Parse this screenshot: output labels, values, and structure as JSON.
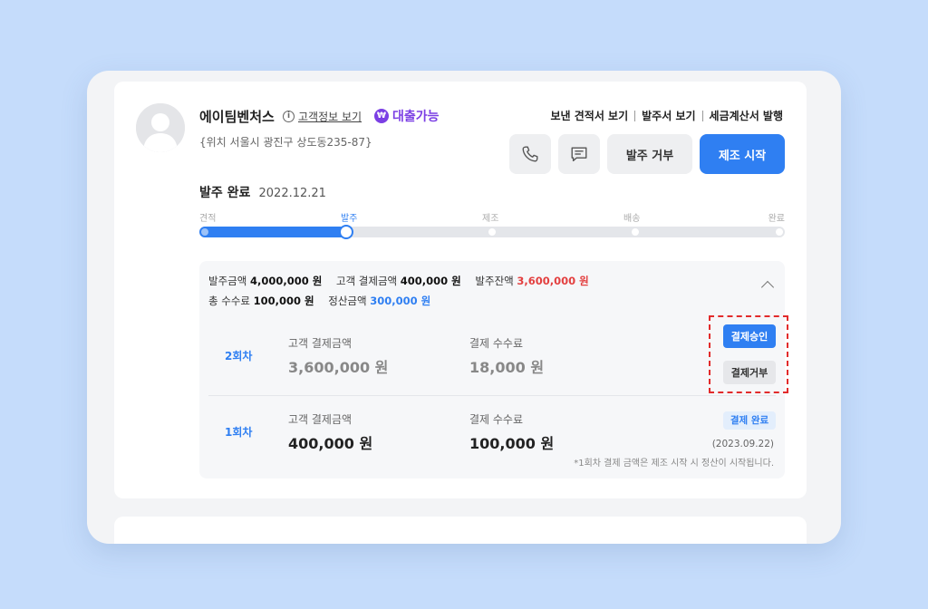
{
  "customer": {
    "name": "에이팀벤처스",
    "info_link": "고객정보 보기",
    "info_icon": "info-icon",
    "loan_badge": "대출가능",
    "loan_icon_glyph": "₩",
    "address": "{위치 서울시 광진구 상도동235-87}"
  },
  "header_links": [
    "보낸 견적서 보기",
    "발주서 보기",
    "세금계산서 발행"
  ],
  "actions": {
    "phone_icon": "phone-icon",
    "chat_icon": "chat-icon",
    "refuse_label": "발주 거부",
    "start_label": "제조 시작"
  },
  "status": {
    "label": "발주 완료",
    "date": "2022.12.21"
  },
  "progress": {
    "steps": [
      "견적",
      "발주",
      "제조",
      "배송",
      "완료"
    ],
    "current_index": 1
  },
  "summary": {
    "order_amount_label": "발주금액",
    "order_amount": "4,000,000 원",
    "customer_paid_label": "고객 결제금액",
    "customer_paid": "400,000 원",
    "order_balance_label": "발주잔액",
    "order_balance": "3,600,000 원",
    "total_fee_label": "총 수수료",
    "total_fee": "100,000 원",
    "settlement_label": "정산금액",
    "settlement": "300,000 원"
  },
  "payments": [
    {
      "round": "2회차",
      "amount_label": "고객 결제금액",
      "amount": "3,600,000 원",
      "fee_label": "결제 수수료",
      "fee": "18,000 원",
      "approve_label": "결제승인",
      "reject_label": "결제거부"
    },
    {
      "round": "1회차",
      "amount_label": "고객 결제금액",
      "amount": "400,000 원",
      "fee_label": "결제 수수료",
      "fee": "100,000 원",
      "status_label": "결제 완료",
      "status_date": "(2023.09.22)"
    }
  ],
  "note": "*1회차 결제 금액은 제조 시작 시 정산이 시작됩니다.",
  "colors": {
    "accent": "#2f7ff2",
    "loan": "#7b3fe4",
    "danger": "#e34040",
    "highlight": "#e22b2b"
  }
}
